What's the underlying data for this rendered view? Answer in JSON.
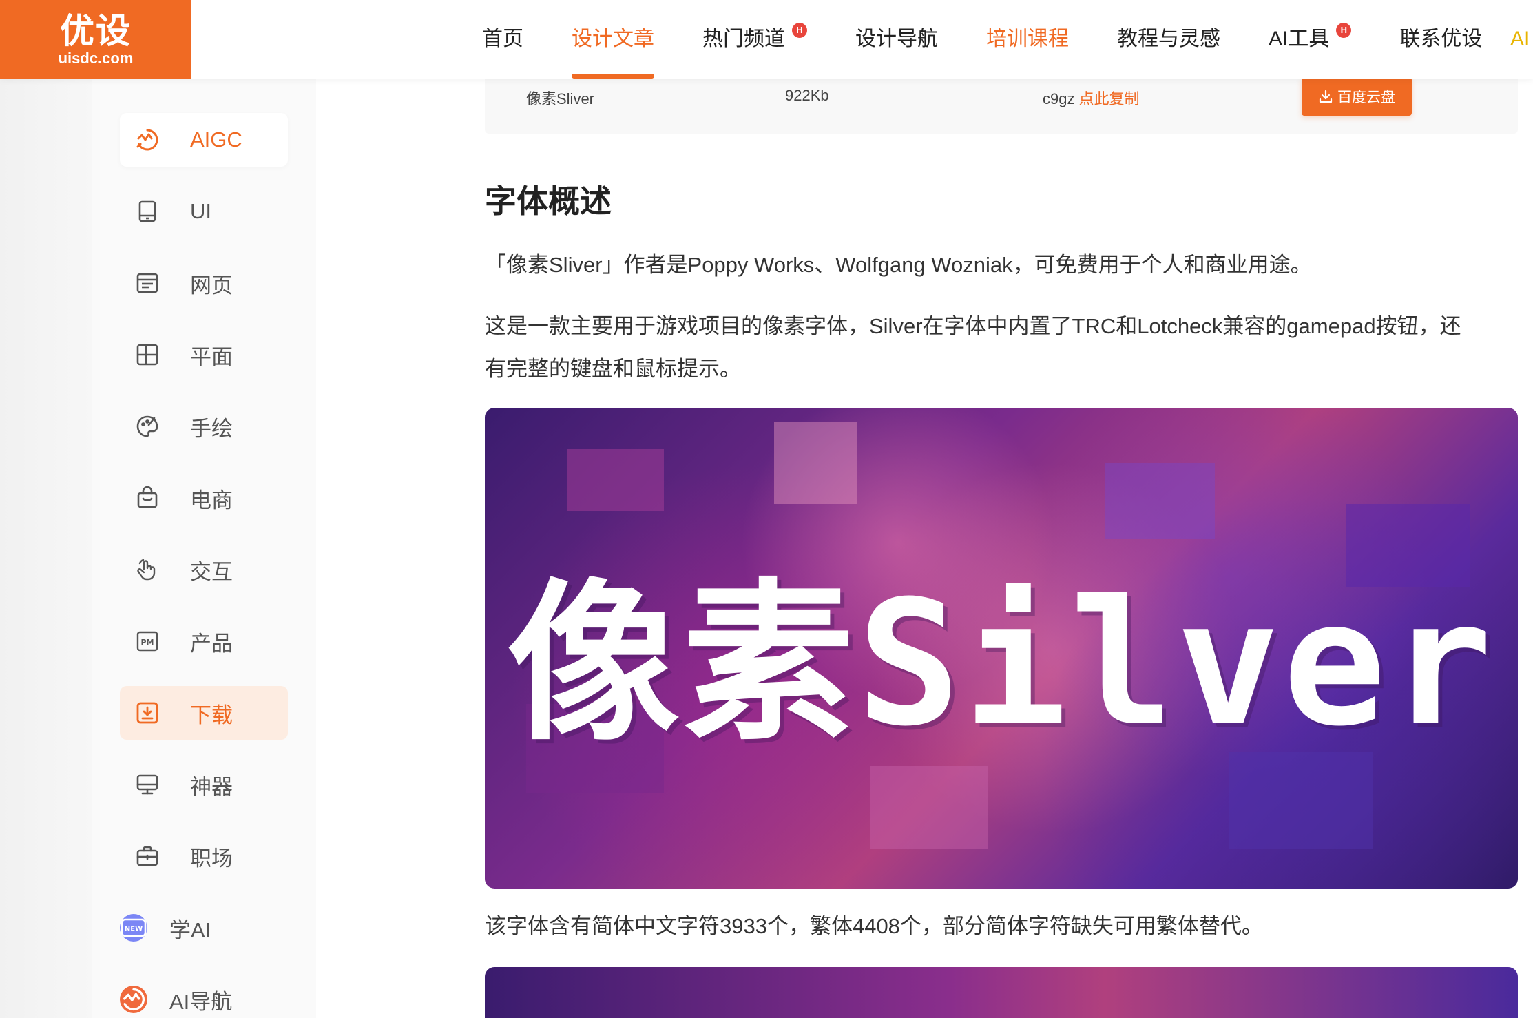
{
  "header": {
    "logo_cn": "优设",
    "logo_en": "uisdc.com",
    "nav": [
      {
        "label": "首页"
      },
      {
        "label": "设计文章"
      },
      {
        "label": "热门频道",
        "badge": "H"
      },
      {
        "label": "设计导航"
      },
      {
        "label": "培训课程"
      },
      {
        "label": "教程与灵感"
      },
      {
        "label": "AI工具",
        "badge": "H"
      },
      {
        "label": "联系优设"
      }
    ],
    "nav_overflow": "AI",
    "active_nav": "设计文章",
    "highlight_nav": "培训课程"
  },
  "sidebar": {
    "items": [
      {
        "label": "AIGC",
        "icon": "aigc-icon"
      },
      {
        "label": "UI",
        "icon": "tablet-icon"
      },
      {
        "label": "网页",
        "icon": "webpage-icon"
      },
      {
        "label": "平面",
        "icon": "layout-icon"
      },
      {
        "label": "手绘",
        "icon": "palette-icon"
      },
      {
        "label": "电商",
        "icon": "shopping-bag-icon"
      },
      {
        "label": "交互",
        "icon": "hand-pointer-icon"
      },
      {
        "label": "产品",
        "icon": "pm-icon"
      },
      {
        "label": "下载",
        "icon": "download-icon"
      },
      {
        "label": "神器",
        "icon": "monitor-icon"
      },
      {
        "label": "职场",
        "icon": "briefcase-icon"
      },
      {
        "label": "学AI",
        "icon": "new-badge-icon"
      },
      {
        "label": "AI导航",
        "icon": "ai-nav-icon"
      }
    ],
    "active_item": "下载",
    "new_badge_text": "NEW"
  },
  "download_bar": {
    "font_name": "像素Sliver",
    "file_size": "922Kb",
    "code": "c9gz",
    "copy_text": "点此复制",
    "button_label": "百度云盘"
  },
  "article": {
    "heading": "字体概述",
    "para1": "「像素Sliver」作者是Poppy Works、Wolfgang Wozniak，可免费用于个人和商业用途。",
    "para2_line1": "这是一款主要用于游戏项目的像素字体，Silver在字体中内置了TRC和Lotcheck兼容的gamepad按钮，还",
    "para2_line2": "有完整的键盘和鼠标提示。",
    "hero_title": "像素Silver",
    "para3": "该字体含有简体中文字符3933个，繁体4408个，部分简体字符缺失可用繁体替代。"
  },
  "colors": {
    "accent": "#f06a23",
    "hot_badge": "#e8453c",
    "sidebar_active_bg": "#fdece1",
    "learn_ai_circle": "#7b86f5",
    "ai_nav_circle": "#f06a3d"
  }
}
